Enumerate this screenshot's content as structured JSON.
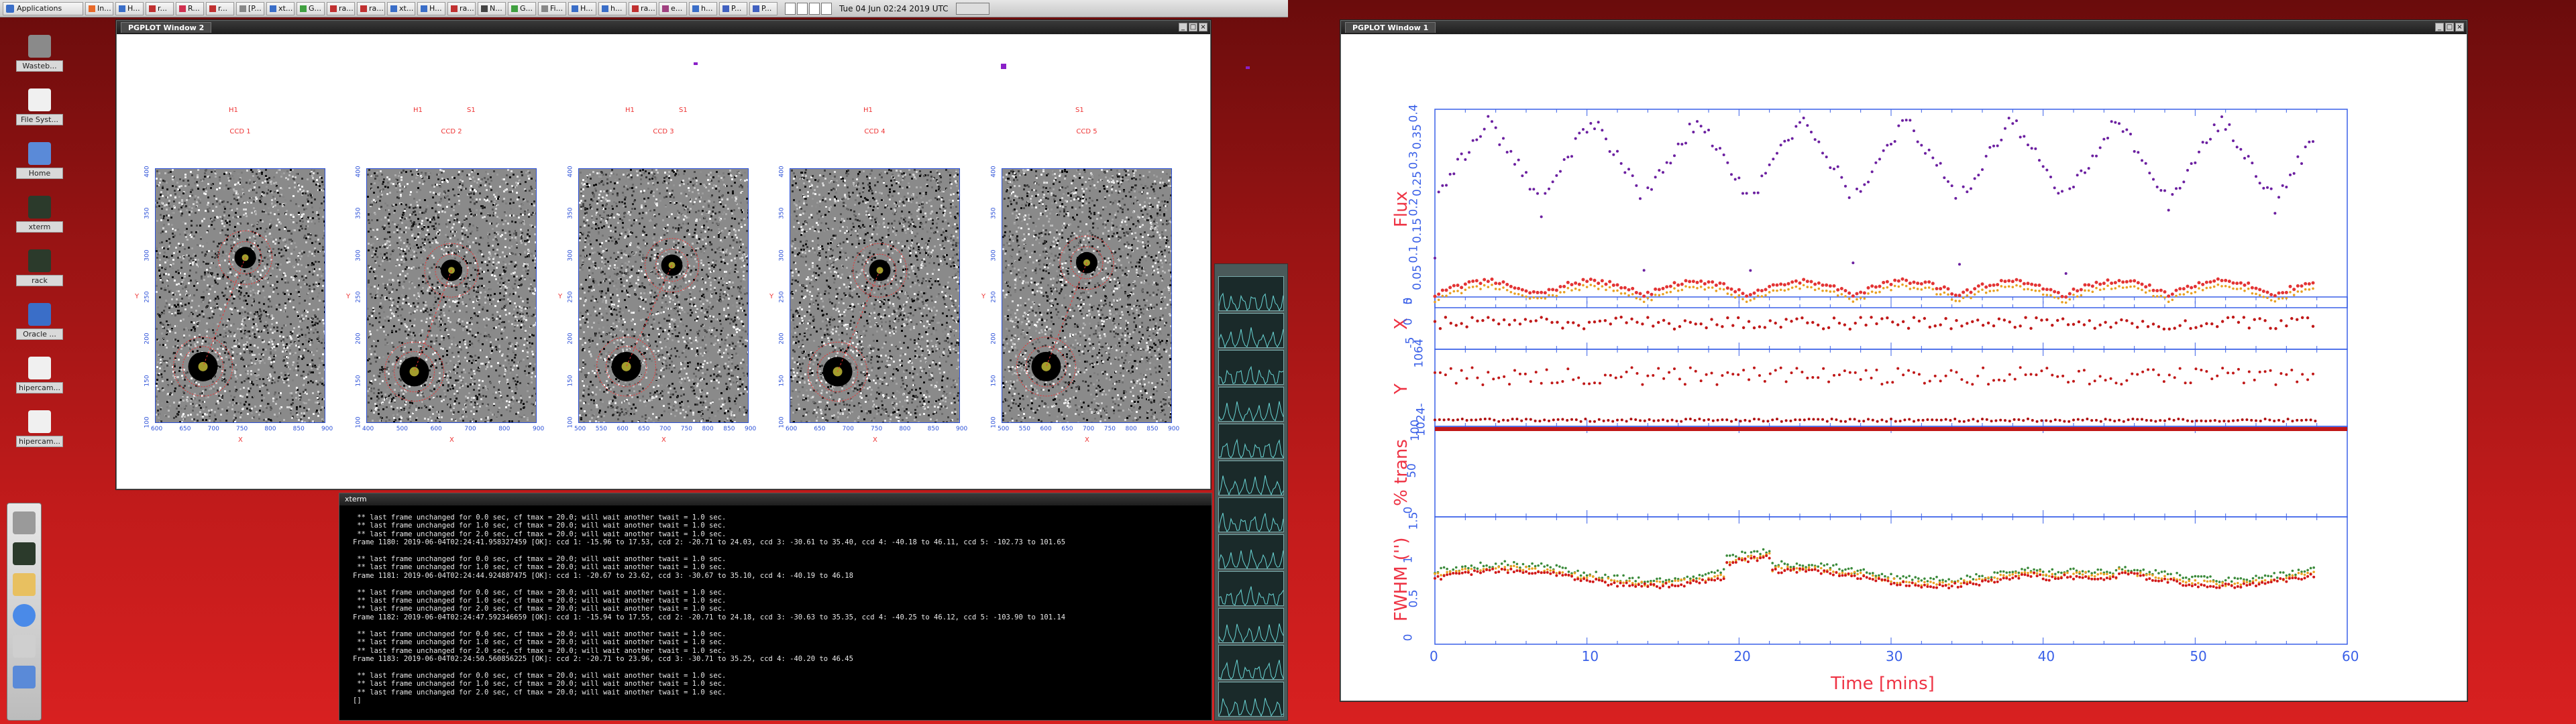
{
  "taskbar": {
    "apps_label": "Applications",
    "tasks": [
      "In...",
      "H...",
      "r...",
      "R...",
      "r...",
      "[P...",
      "xt...",
      "G...",
      "ra...",
      "ra...",
      "xt...",
      "H...",
      "ra...",
      "N...",
      "G...",
      "Fi...",
      "H...",
      "h...",
      "ra...",
      "e...",
      "h...",
      "P...",
      "P..."
    ],
    "clock": "Tue 04 Jun 02:24 2019 UTC"
  },
  "desktop_icons": [
    "Wasteb...",
    "File Syst...",
    "Home",
    "xterm",
    "rack",
    "Oracle ...",
    "hipercam...",
    "hipercam..."
  ],
  "pgplot2": {
    "title": "PGPLOT Window 2",
    "ccds": [
      {
        "title": "CCD 1",
        "labels": [
          "H1"
        ],
        "xticks": [
          "600",
          "650",
          "700",
          "750",
          "800",
          "850",
          "900"
        ],
        "yticks": [
          "100",
          "150",
          "200",
          "250",
          "300",
          "350",
          "400"
        ],
        "xlabel": "X",
        "ylabel": "Y"
      },
      {
        "title": "CCD 2",
        "labels": [
          "H1",
          "S1"
        ],
        "xticks": [
          "400",
          "500",
          "600",
          "700",
          "800",
          "900"
        ],
        "yticks": [
          "100",
          "150",
          "200",
          "250",
          "300",
          "350",
          "400"
        ],
        "xlabel": "X",
        "ylabel": "Y"
      },
      {
        "title": "CCD 3",
        "labels": [
          "H1",
          "S1"
        ],
        "xticks": [
          "500",
          "550",
          "600",
          "650",
          "700",
          "750",
          "800",
          "850",
          "900"
        ],
        "yticks": [
          "100",
          "150",
          "200",
          "250",
          "300",
          "350",
          "400"
        ],
        "xlabel": "X",
        "ylabel": "Y"
      },
      {
        "title": "CCD 4",
        "labels": [
          "H1"
        ],
        "xticks": [
          "600",
          "650",
          "700",
          "750",
          "800",
          "850",
          "900"
        ],
        "yticks": [
          "100",
          "150",
          "200",
          "250",
          "300",
          "350",
          "400"
        ],
        "xlabel": "X",
        "ylabel": "Y"
      },
      {
        "title": "CCD 5",
        "labels": [
          "S1"
        ],
        "xticks": [
          "500",
          "550",
          "600",
          "650",
          "700",
          "750",
          "800",
          "850",
          "900"
        ],
        "yticks": [
          "100",
          "150",
          "200",
          "250",
          "300",
          "350",
          "400"
        ],
        "xlabel": "X",
        "ylabel": "Y"
      }
    ]
  },
  "xterm": {
    "title": "xterm",
    "lines": [
      " ** last frame unchanged for 0.0 sec, cf tmax = 20.0; will wait another twait = 1.0 sec.",
      " ** last frame unchanged for 1.0 sec, cf tmax = 20.0; will wait another twait = 1.0 sec.",
      " ** last frame unchanged for 2.0 sec, cf tmax = 20.0; will wait another twait = 1.0 sec.",
      "Frame 1180: 2019-06-04T02:24:41.958327459 [OK]: ccd 1: -15.96 to 17.53, ccd 2: -20.71 to 24.03, ccd 3: -30.61 to 35.40, ccd 4: -40.18 to 46.11, ccd 5: -102.73 to 101.65",
      "",
      " ** last frame unchanged for 0.0 sec, cf tmax = 20.0; will wait another twait = 1.0 sec.",
      " ** last frame unchanged for 1.0 sec, cf tmax = 20.0; will wait another twait = 1.0 sec.",
      "Frame 1181: 2019-06-04T02:24:44.924887475 [OK]: ccd 1: -20.67 to 23.62, ccd 3: -30.67 to 35.10, ccd 4: -40.19 to 46.18",
      "",
      " ** last frame unchanged for 0.0 sec, cf tmax = 20.0; will wait another twait = 1.0 sec.",
      " ** last frame unchanged for 1.0 sec, cf tmax = 20.0; will wait another twait = 1.0 sec.",
      " ** last frame unchanged for 2.0 sec, cf tmax = 20.0; will wait another twait = 1.0 sec.",
      "Frame 1182: 2019-06-04T02:24:47.592346659 [OK]: ccd 1: -15.94 to 17.55, ccd 2: -20.71 to 24.18, ccd 3: -30.63 to 35.35, ccd 4: -40.25 to 46.12, ccd 5: -103.90 to 101.14",
      "",
      " ** last frame unchanged for 0.0 sec, cf tmax = 20.0; will wait another twait = 1.0 sec.",
      " ** last frame unchanged for 1.0 sec, cf tmax = 20.0; will wait another twait = 1.0 sec.",
      " ** last frame unchanged for 2.0 sec, cf tmax = 20.0; will wait another twait = 1.0 sec.",
      "Frame 1183: 2019-06-04T02:24:50.560856225 [OK]: ccd 2: -20.71 to 23.96, ccd 3: -30.71 to 35.25, ccd 4: -40.20 to 46.45",
      "",
      " ** last frame unchanged for 0.0 sec, cf tmax = 20.0; will wait another twait = 1.0 sec.",
      " ** last frame unchanged for 1.0 sec, cf tmax = 20.0; will wait another twait = 1.0 sec.",
      " ** last frame unchanged for 2.0 sec, cf tmax = 20.0; will wait another twait = 1.0 sec.",
      "[]"
    ]
  },
  "pgplot1": {
    "title": "PGPLOT Window 1",
    "xlabel": "Time [mins]",
    "xticks": [
      "0",
      "10",
      "20",
      "30",
      "40",
      "50",
      "60"
    ],
    "panels": [
      {
        "ylabel": "Flux",
        "yticks": [
          "0",
          "0.05",
          "0.1",
          "0.15",
          "0.2",
          "0.25",
          "0.3",
          "0.35",
          "0.4"
        ]
      },
      {
        "ylabel": "X",
        "yticks": [
          "-5",
          "0",
          "5"
        ]
      },
      {
        "ylabel": "Y",
        "yticks": [
          "1024-",
          "1064"
        ]
      },
      {
        "ylabel": "% trans",
        "yticks": [
          "0",
          "50",
          "100"
        ]
      },
      {
        "ylabel": "FWHM ('')",
        "yticks": [
          "0",
          "0.5",
          "1",
          "1.5"
        ]
      }
    ]
  },
  "colors": {
    "plot_red": "#e33333",
    "axis_blue": "#3a60e8",
    "purple": "#6b1fa0"
  },
  "chart_data": [
    {
      "type": "scatter",
      "title": "",
      "xlabel": "Time [mins]",
      "ylabel": "Flux",
      "xlim": [
        0,
        60
      ],
      "ylim": [
        0,
        0.4
      ],
      "series": [
        {
          "values_desc": "purple",
          "x": [
            0,
            2,
            4,
            6,
            7,
            8,
            10,
            12,
            14,
            16,
            18,
            20,
            21,
            22,
            24,
            26,
            28,
            30,
            32,
            34,
            35,
            36,
            38,
            40,
            42,
            44,
            46,
            48,
            49,
            50,
            52,
            54,
            56,
            58
          ],
          "y": [
            0.22,
            0.33,
            0.39,
            0.3,
            0.1,
            0.3,
            0.38,
            0.33,
            0.24,
            0.34,
            0.4,
            0.31,
            0.05,
            0.3,
            0.38,
            0.33,
            0.24,
            0.34,
            0.39,
            0.3,
            0.05,
            0.3,
            0.38,
            0.32,
            0.25,
            0.34,
            0.39,
            0.31,
            0.05,
            0.3,
            0.38,
            0.33,
            0.25,
            0.38
          ]
        },
        {
          "values_desc": "red",
          "x": [
            0,
            2,
            4,
            6,
            7,
            8,
            10,
            12,
            14,
            16,
            18,
            20,
            21,
            22,
            24,
            26,
            28,
            30,
            32,
            34,
            35,
            36,
            38,
            40,
            42,
            44,
            46,
            48,
            49,
            50,
            52,
            54,
            56,
            58
          ],
          "y": [
            0.02,
            0.03,
            0.04,
            0.03,
            0.01,
            0.03,
            0.04,
            0.03,
            0.02,
            0.03,
            0.04,
            0.03,
            0.01,
            0.03,
            0.04,
            0.03,
            0.02,
            0.03,
            0.04,
            0.03,
            0.01,
            0.03,
            0.04,
            0.03,
            0.02,
            0.03,
            0.04,
            0.03,
            0.01,
            0.03,
            0.04,
            0.03,
            0.02,
            0.04
          ]
        }
      ]
    },
    {
      "type": "scatter",
      "xlabel": "",
      "ylabel": "X",
      "xlim": [
        0,
        60
      ],
      "ylim": [
        -5,
        5
      ]
    },
    {
      "type": "scatter",
      "xlabel": "",
      "ylabel": "Y",
      "xlim": [
        0,
        60
      ]
    },
    {
      "type": "scatter",
      "xlabel": "",
      "ylabel": "% trans",
      "xlim": [
        0,
        60
      ],
      "ylim": [
        0,
        100
      ]
    },
    {
      "type": "scatter",
      "xlabel": "Time [mins]",
      "ylabel": "FWHM ('')",
      "xlim": [
        0,
        60
      ],
      "ylim": [
        0,
        1.5
      ]
    }
  ]
}
